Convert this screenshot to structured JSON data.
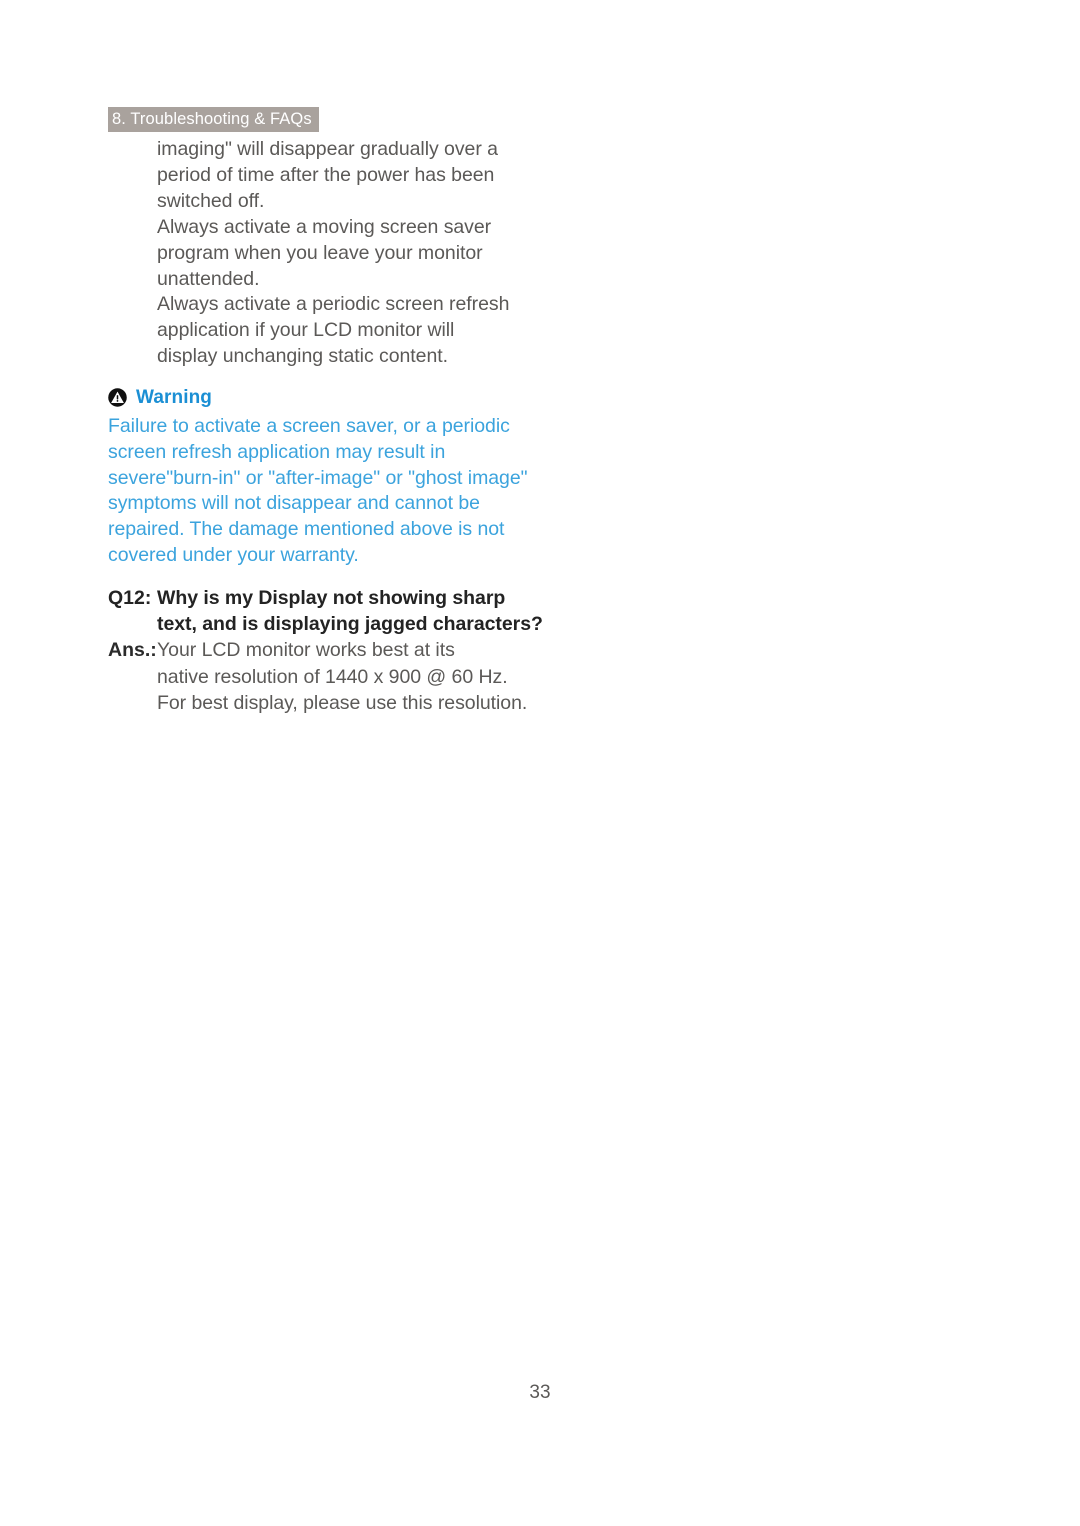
{
  "document": {
    "section_badge": "8. Troubleshooting & FAQs",
    "page_number": "33"
  },
  "body_paragraphs": {
    "lines": [
      "imaging\" will disappear gradually over a",
      "period of time after the power has been",
      "switched off.",
      "Always activate a moving screen saver",
      "program when you leave your monitor",
      "unattended.",
      "Always activate a periodic screen refresh",
      "application if your LCD monitor will",
      "display unchanging static content."
    ]
  },
  "warning": {
    "icon": "warning-triangle-icon",
    "title": "Warning",
    "color": "#3ba3dd",
    "lines": [
      "Failure to activate a screen saver, or a periodic",
      "screen refresh application may result in",
      "severe\"burn-in\" or \"after-image\" or \"ghost image\"",
      "symptoms will not disappear and cannot be",
      "repaired. The damage mentioned above is not",
      "covered under your warranty."
    ]
  },
  "faq": {
    "question": {
      "label": "Q12:",
      "lines": [
        "Why is my Display not showing sharp",
        "text, and is displaying jagged characters?"
      ]
    },
    "answer": {
      "label": "Ans.:",
      "lines": [
        "Your LCD monitor works best at its",
        "native resolution of 1440 x 900 @ 60 Hz.",
        "For best display, please use this resolution."
      ]
    }
  },
  "colors": {
    "badge_background": "#a9a29d",
    "badge_text": "#ffffff",
    "body_text": "#5b5957",
    "warning_text": "#3ba3dd",
    "warning_title": "#1b8fd4",
    "heading_text": "#232323"
  }
}
